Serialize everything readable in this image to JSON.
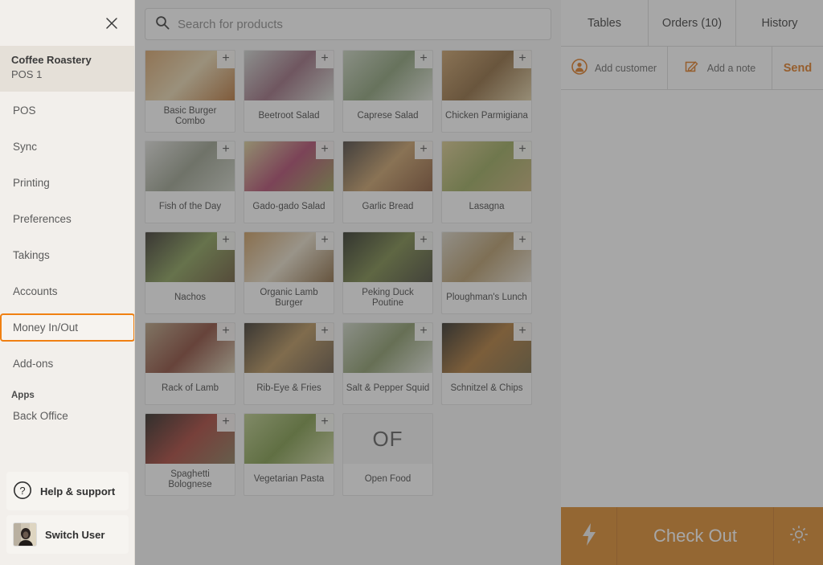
{
  "colors": {
    "accent_orange": "#f08012",
    "checkout_orange": "#dd8a2c",
    "drawer_bg": "#f2efeb",
    "account_bg": "#e5e0d8",
    "send_orange": "#e07b21"
  },
  "drawer": {
    "close_label": "×",
    "account": {
      "name": "Coffee Roastery",
      "subtitle": "POS 1"
    },
    "nav_items": [
      {
        "label": "POS",
        "focused": false
      },
      {
        "label": "Sync",
        "focused": false
      },
      {
        "label": "Printing",
        "focused": false
      },
      {
        "label": "Preferences",
        "focused": false
      },
      {
        "label": "Takings",
        "focused": false
      },
      {
        "label": "Accounts",
        "focused": false
      },
      {
        "label": "Money In/Out",
        "focused": true
      },
      {
        "label": "Add-ons",
        "focused": false
      }
    ],
    "section_heading": "Apps",
    "apps_items": [
      {
        "label": "Back Office"
      }
    ],
    "help_label": "Help & support",
    "switch_user_label": "Switch User"
  },
  "search": {
    "placeholder": "Search for products",
    "value": "",
    "icon": "search-icon"
  },
  "products": [
    {
      "name": "Basic Burger Combo",
      "type": "image",
      "plus": "+"
    },
    {
      "name": "Beetroot Salad",
      "type": "image",
      "plus": "+"
    },
    {
      "name": "Caprese Salad",
      "type": "image",
      "plus": "+"
    },
    {
      "name": "Chicken Parmigiana",
      "type": "image",
      "plus": "+"
    },
    {
      "name": "Fish of the Day",
      "type": "image",
      "plus": "+"
    },
    {
      "name": "Gado-gado Salad",
      "type": "image",
      "plus": "+"
    },
    {
      "name": "Garlic Bread",
      "type": "image",
      "plus": "+"
    },
    {
      "name": "Lasagna",
      "type": "image",
      "plus": "+"
    },
    {
      "name": "Nachos",
      "type": "image",
      "plus": "+"
    },
    {
      "name": "Organic Lamb Burger",
      "type": "image",
      "plus": "+"
    },
    {
      "name": "Peking Duck Poutine",
      "type": "image",
      "plus": "+"
    },
    {
      "name": "Ploughman's Lunch",
      "type": "image",
      "plus": "+"
    },
    {
      "name": "Rack of Lamb",
      "type": "image",
      "plus": "+"
    },
    {
      "name": "Rib-Eye & Fries",
      "type": "image",
      "plus": "+"
    },
    {
      "name": "Salt & Pepper Squid",
      "type": "image",
      "plus": "+"
    },
    {
      "name": "Schnitzel & Chips",
      "type": "image",
      "plus": "+"
    },
    {
      "name": "Spaghetti Bolognese",
      "type": "image",
      "plus": "+"
    },
    {
      "name": "Vegetarian Pasta",
      "type": "image",
      "plus": "+"
    },
    {
      "name": "Open Food",
      "type": "initials",
      "initials": "OF",
      "plus": ""
    }
  ],
  "order_panel": {
    "tabs": [
      {
        "label": "Tables"
      },
      {
        "label": "Orders (10)"
      },
      {
        "label": "History"
      }
    ],
    "actions": [
      {
        "label": "Add customer",
        "icon": "customer-icon"
      },
      {
        "label": "Add a note",
        "icon": "note-pencil-icon"
      },
      {
        "label": "Send",
        "icon": ""
      }
    ]
  },
  "checkout": {
    "flash_icon": "lightning-bolt-icon",
    "label": "Check Out",
    "gear_icon": "gear-icon"
  }
}
